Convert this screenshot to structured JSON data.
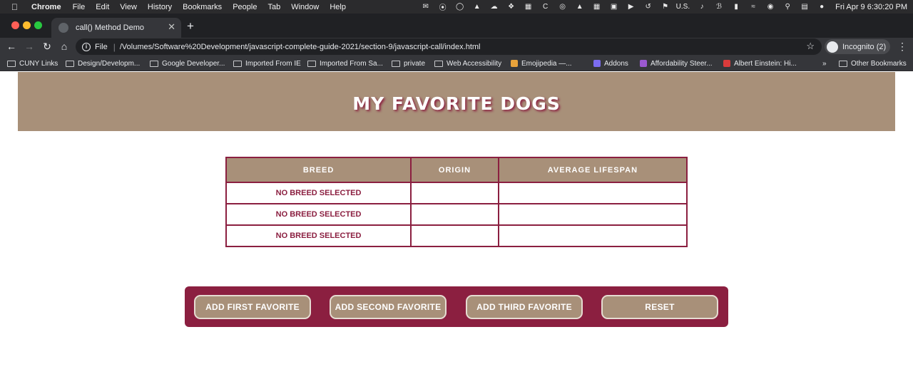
{
  "menubar": {
    "app_name": "Chrome",
    "items": [
      "File",
      "Edit",
      "View",
      "History",
      "Bookmarks",
      "People",
      "Tab",
      "Window",
      "Help"
    ],
    "input_source": "U.S.",
    "clock": "Fri Apr 9  6:30:20 PM"
  },
  "browser": {
    "tab_title": "call() Method Demo",
    "scheme_label": "File",
    "url": "/Volumes/Software%20Development/javascript-complete-guide-2021/section-9/javascript-call/index.html",
    "profile_label": "Incognito (2)",
    "bookmarks": [
      {
        "label": "CUNY Links",
        "icon": "folder-icon"
      },
      {
        "label": "Design/Developm...",
        "icon": "folder-icon"
      },
      {
        "label": "Google Developer...",
        "icon": "folder-icon"
      },
      {
        "label": "Imported From IE",
        "icon": "folder-icon"
      },
      {
        "label": "Imported From Sa...",
        "icon": "folder-icon"
      },
      {
        "label": "private",
        "icon": "folder-icon"
      },
      {
        "label": "Web Accessibility",
        "icon": "folder-icon"
      },
      {
        "label": "Emojipedia —...",
        "icon": "site-icon"
      },
      {
        "label": "Addons",
        "icon": "site-icon"
      },
      {
        "label": "Affordability Steer...",
        "icon": "site-icon"
      },
      {
        "label": "Albert Einstein: Hi...",
        "icon": "site-icon"
      }
    ],
    "more_bookmarks": "»",
    "other_bookmarks": "Other Bookmarks"
  },
  "page": {
    "title": "MY FAVORITE DOGS",
    "table": {
      "headers": [
        "BREED",
        "ORIGIN",
        "AVERAGE LIFESPAN"
      ],
      "rows": [
        [
          "NO BREED SELECTED",
          "",
          ""
        ],
        [
          "NO BREED SELECTED",
          "",
          ""
        ],
        [
          "NO BREED SELECTED",
          "",
          ""
        ]
      ]
    },
    "buttons": {
      "first": "ADD FIRST FAVORITE",
      "second": "ADD SECOND FAVORITE",
      "third": "ADD THIRD FAVORITE",
      "reset": "RESET"
    },
    "colors": {
      "accent": "#8b1f40",
      "tan": "#a89079"
    }
  }
}
